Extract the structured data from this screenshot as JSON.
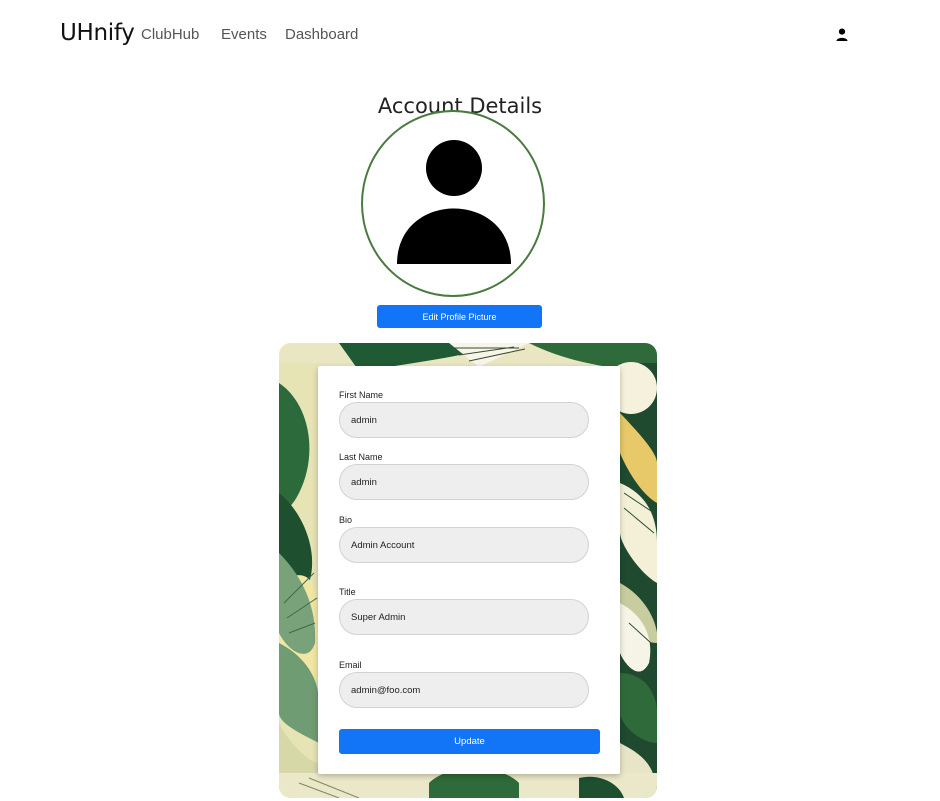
{
  "nav": {
    "brand": "UHnify",
    "links": [
      "ClubHub",
      "Events",
      "Dashboard"
    ],
    "user_icon": "user-icon"
  },
  "page": {
    "title": "Account Details",
    "edit_picture_label": "Edit Profile Picture"
  },
  "form": {
    "fields": [
      {
        "label": "First Name",
        "value": "admin"
      },
      {
        "label": "Last Name",
        "value": "admin"
      },
      {
        "label": "Bio",
        "value": "Admin Account"
      },
      {
        "label": "Title",
        "value": "Super Admin"
      },
      {
        "label": "Email",
        "value": "admin@foo.com"
      }
    ],
    "submit_label": "Update"
  },
  "colors": {
    "primary": "#1274f6",
    "avatar_border": "#4a7a3f",
    "input_bg": "#eeeeee"
  }
}
